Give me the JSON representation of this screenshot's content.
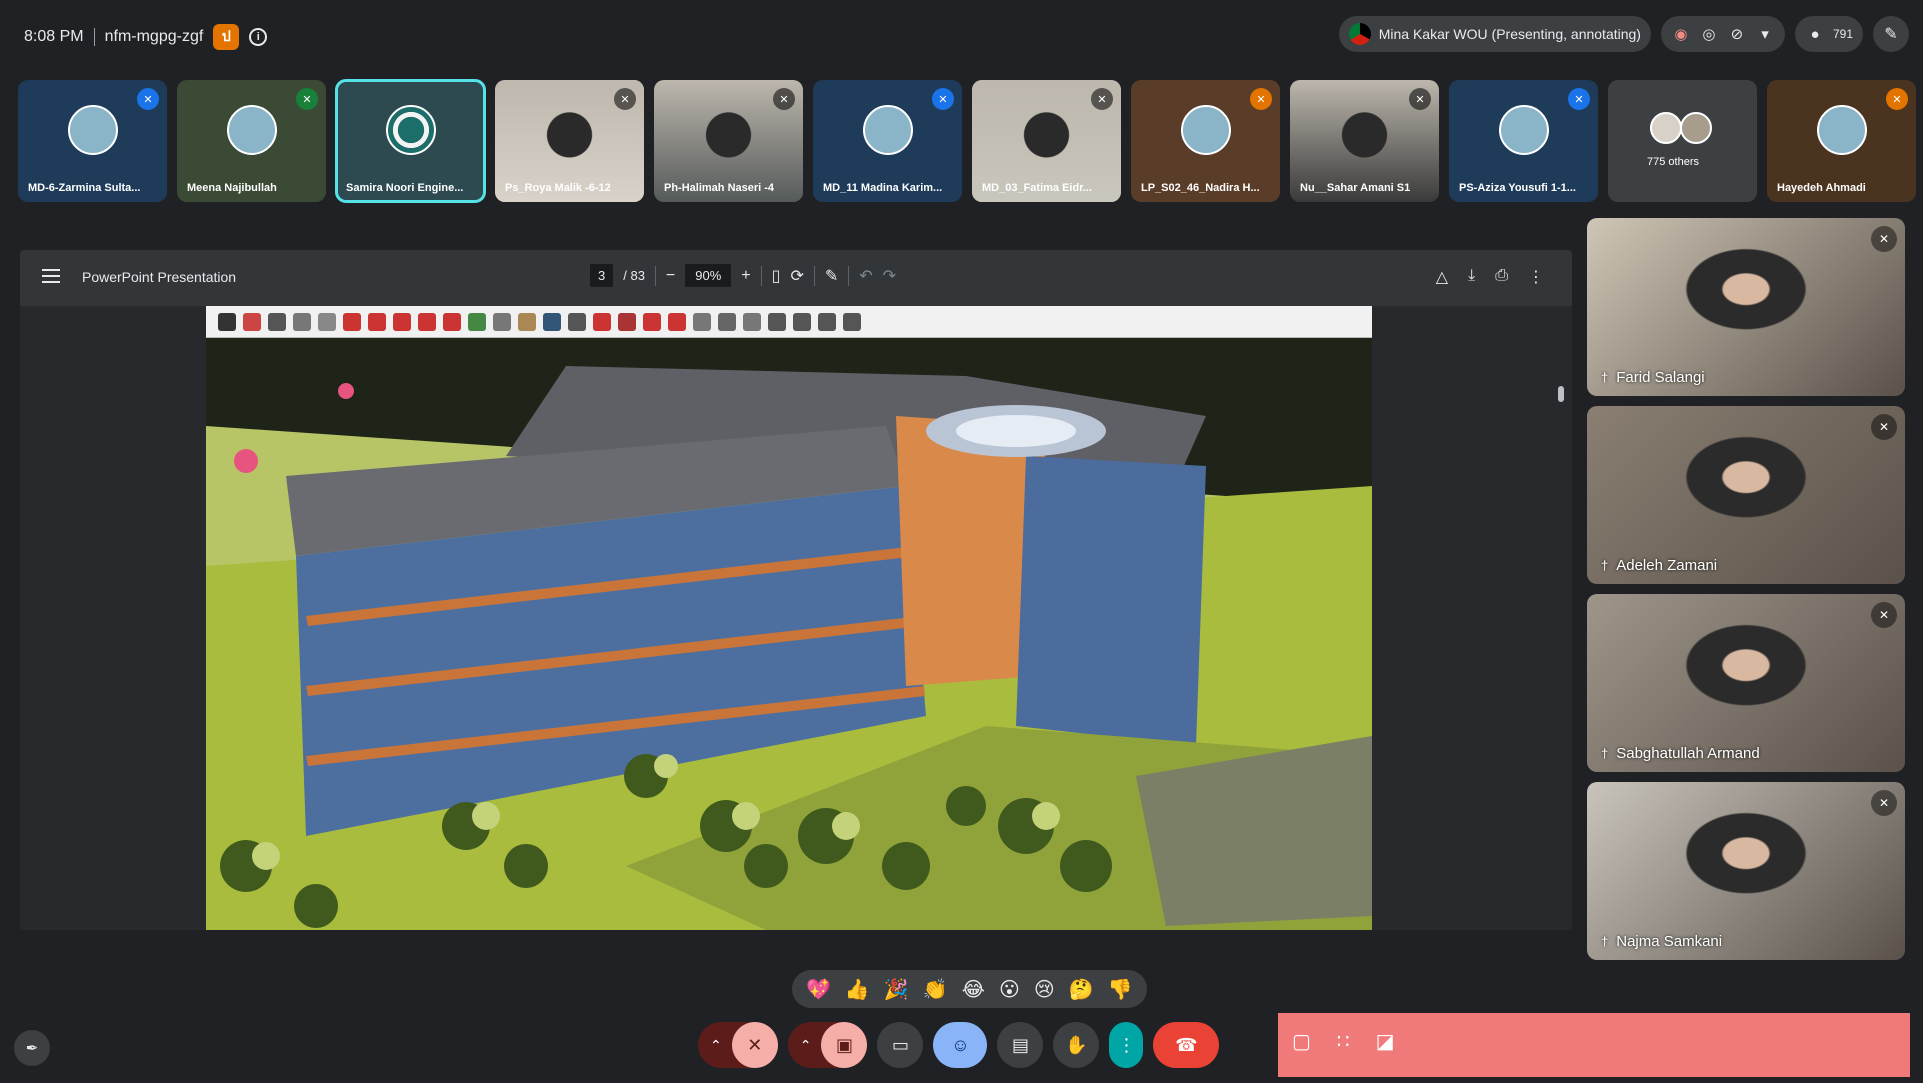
{
  "meeting": {
    "time": "8:08 PM",
    "code": "nfm-mgpg-zgf",
    "host_badge": "ป",
    "info_icon": "i"
  },
  "presenter": {
    "label": "Mina Kakar WOU (Presenting, annotating)",
    "participant_count": "791"
  },
  "participants": [
    {
      "name": "MD-6-Zarmina Sulta...",
      "mic": "blue",
      "bg": "#1f3b5a"
    },
    {
      "name": "Meena Najibullah",
      "mic": "green",
      "bg": "#3b4a34"
    },
    {
      "name": "Samira Noori Engine...",
      "mic": "none",
      "bg": "#2d4a50",
      "active": true
    },
    {
      "name": "Ps_Roya Malik -6-12",
      "mic": "dark",
      "bg": "#d9d2c8",
      "photo": true
    },
    {
      "name": "Ph-Halimah Naseri -4",
      "mic": "dark",
      "bg": "#555a5a",
      "photo": true
    },
    {
      "name": "MD_11 Madina Karim...",
      "mic": "blue",
      "bg": "#1f3b5a"
    },
    {
      "name": "MD_03_Fatima Eidr...",
      "mic": "dark",
      "bg": "#c9c6bc",
      "photo": true
    },
    {
      "name": "LP_S02_46_Nadira H...",
      "mic": "orange",
      "bg": "#5a3d28"
    },
    {
      "name": "Nu__Sahar Amani S1",
      "mic": "dark",
      "bg": "#3a3a3a",
      "photo": true
    },
    {
      "name": "PS-Aziza Yousufi 1-1...",
      "mic": "blue",
      "bg": "#1f3b5a"
    },
    {
      "name": "775 others",
      "mic": "none",
      "bg": "#3c4043",
      "others": true
    },
    {
      "name": "Hayedeh Ahmadi",
      "mic": "orange",
      "bg": "#4a3420"
    }
  ],
  "presentation": {
    "title": "PowerPoint Presentation",
    "page_current": "3",
    "page_total": "/ 83",
    "zoom": "90%"
  },
  "side_videos": [
    {
      "name": "Farid Salangi",
      "bg": "#cfc6b6"
    },
    {
      "name": "Adeleh Zamani",
      "bg": "#8a7f72"
    },
    {
      "name": "Sabghatullah Armand",
      "bg": "#9e968a"
    },
    {
      "name": "Najma Samkani",
      "bg": "#c9c4bc"
    }
  ],
  "reactions": [
    "💖",
    "👍",
    "🎉",
    "👏",
    "😂",
    "😮",
    "😢",
    "🤔",
    "👎"
  ],
  "icons": {
    "broadcast": "◉",
    "eye": "◎",
    "no-caption": "⊘",
    "chevron-down": "▾",
    "pen": "✎",
    "mic-off": "✕",
    "chevron-up": "⌃",
    "cam-off": "▣",
    "present": "▭",
    "emoji": "☺",
    "captions": "▤",
    "hand": "✋",
    "more": "⋮",
    "hangup": "☎",
    "chat": "▢",
    "apps": "∷",
    "lock": "◪",
    "pin": "†",
    "pen-off": "✒"
  }
}
